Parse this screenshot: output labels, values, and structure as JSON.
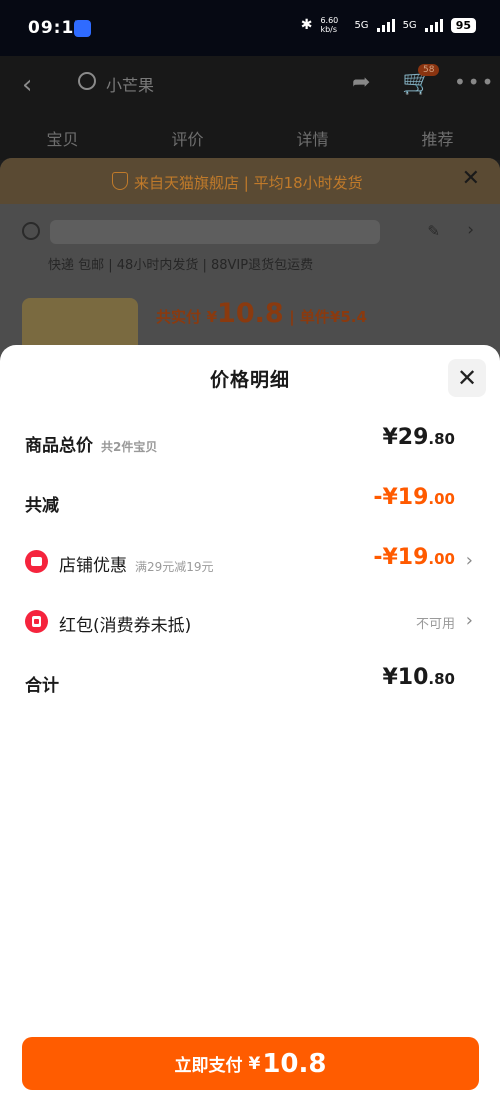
{
  "status_bar": {
    "time": "09:17",
    "net_speed": "6.60 kb/s",
    "net_1": "5G",
    "net_2": "5G",
    "battery": "95"
  },
  "bg_page": {
    "search_text": "小芒果",
    "cart_badge": "58",
    "tabs": [
      "宝贝",
      "评价",
      "详情",
      "推荐"
    ],
    "notice": "来自天猫旗舰店 | 平均18小时发货",
    "service_tags": "快递 包邮 | 48小时内发货 | 88VIP退货包运费",
    "price_label": "共实付",
    "price_currency": "¥",
    "price_value": "10.8",
    "unit_label": "| 单件¥5.4"
  },
  "sheet": {
    "title": "价格明细",
    "rows": [
      {
        "label": "商品总价",
        "sub": "共2件宝贝",
        "currency": "¥",
        "int": "29",
        "dec": ".80"
      },
      {
        "label": "共减",
        "currency": "-¥",
        "int": "19",
        "dec": ".00"
      },
      {
        "label": "店铺优惠",
        "sub": "满29元减19元",
        "currency": "-¥",
        "int": "19",
        "dec": ".00"
      },
      {
        "label": "红包(消费券未抵)",
        "value_text": "不可用"
      },
      {
        "label": "合计",
        "currency": "¥",
        "int": "10",
        "dec": ".80"
      }
    ]
  },
  "pay_button": {
    "label": "立即支付",
    "currency": "¥",
    "amount": "10.8"
  },
  "colors": {
    "accent": "#ff5c00",
    "discount": "#ff5a00",
    "icon_red": "#f5243d"
  },
  "icons": [
    "back-arrow-icon",
    "search-icon",
    "share-icon",
    "cart-icon",
    "more-icon",
    "shield-icon",
    "close-icon",
    "location-icon",
    "edit-icon",
    "chevron-right-icon",
    "store-coupon-icon",
    "red-packet-icon"
  ]
}
